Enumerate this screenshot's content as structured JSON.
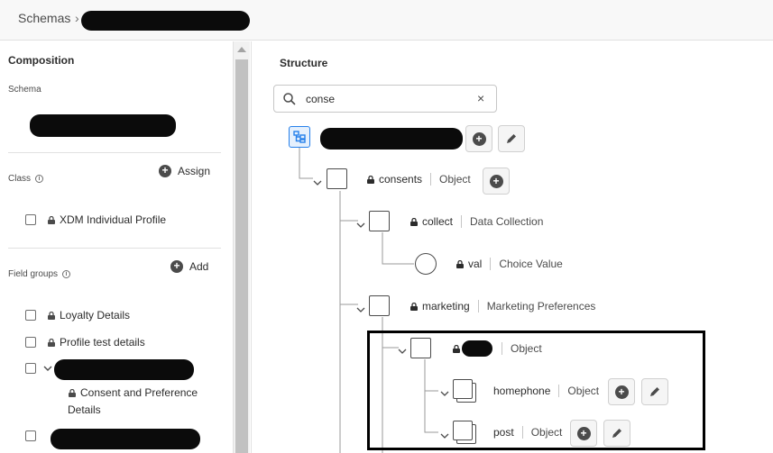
{
  "header": {
    "breadcrumb_root": "Schemas",
    "breadcrumb_sep": "›"
  },
  "composition": {
    "title": "Composition",
    "schema_label": "Schema",
    "class_label": "Class",
    "assign_label": "Assign",
    "class_item": "XDM Individual Profile",
    "field_groups_label": "Field groups",
    "add_label": "Add",
    "field_groups": [
      "Loyalty Details",
      "Profile test details"
    ],
    "sub_item_line1": "Consent and Preference",
    "sub_item_line2": "Details"
  },
  "structure": {
    "title": "Structure",
    "search_value": "conse",
    "clear_glyph": "×",
    "nodes": [
      {
        "name": "consents",
        "type": "Object"
      },
      {
        "name": "collect",
        "type": "Data Collection"
      },
      {
        "name": "val",
        "type": "Choice Value"
      },
      {
        "name": "marketing",
        "type": "Marketing Preferences"
      },
      {
        "name": "",
        "type": "Object"
      },
      {
        "name": "homephone",
        "type": "Object"
      },
      {
        "name": "post",
        "type": "Object"
      }
    ]
  },
  "icons": {
    "search": "search-icon",
    "lock": "lock-icon",
    "add": "add-circle-icon",
    "edit": "pencil-icon",
    "chevron": "chevron-down-icon",
    "info": "info-icon",
    "tree": "schema-tree-icon"
  },
  "colors": {
    "accent": "#2680eb",
    "redaction": "#0b0b0b",
    "highlight_border": "#000000"
  }
}
